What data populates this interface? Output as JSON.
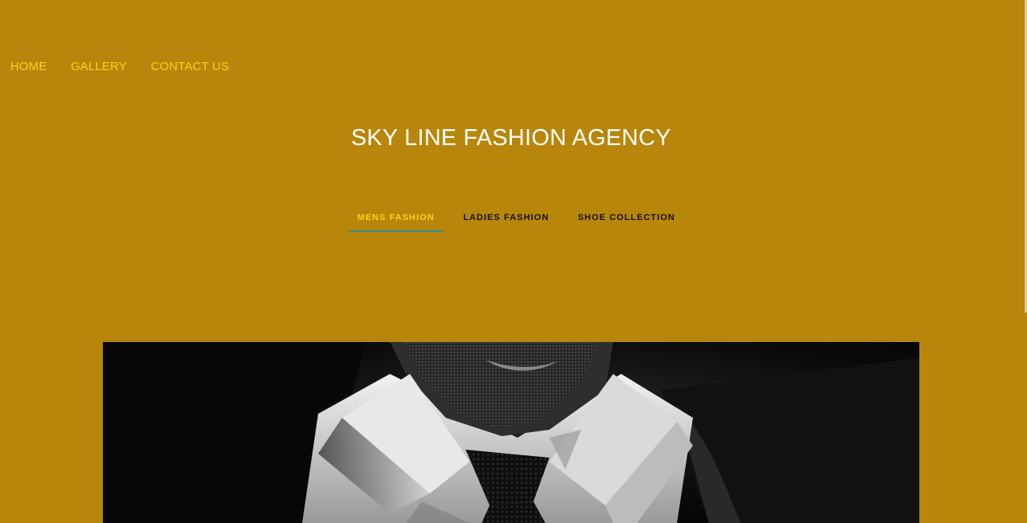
{
  "nav": {
    "items": [
      {
        "label": "HOME"
      },
      {
        "label": "GALLERY"
      },
      {
        "label": "CONTACT US"
      }
    ]
  },
  "header": {
    "title": "SKY LINE FASHION AGENCY"
  },
  "tabs": [
    {
      "label": "MENS FASHION",
      "active": true
    },
    {
      "label": "LADIES FASHION",
      "active": false
    },
    {
      "label": "SHOE COLLECTION",
      "active": false
    }
  ],
  "hero": {
    "image": "man-in-white-shirt-and-knit-tie-photo"
  },
  "colors": {
    "background": "#b8860b",
    "nav_link": "#f7d417",
    "title": "#ffffff",
    "tab_active": "#f7d417",
    "tab_inactive": "#111111",
    "tab_underline": "#2f8f8d"
  }
}
